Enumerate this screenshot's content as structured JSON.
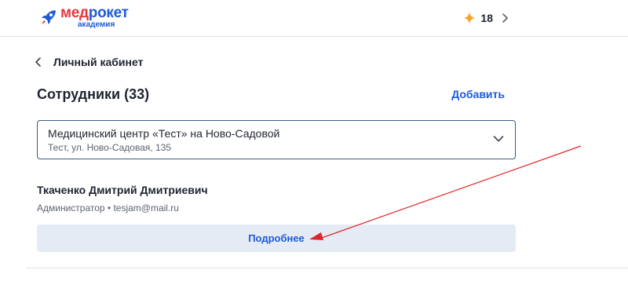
{
  "header": {
    "logo": {
      "brand_part1": "мед",
      "brand_part2": "рокет",
      "sub": "академия"
    },
    "bonus": {
      "count": "18",
      "icon": "star-icon"
    },
    "colors": {
      "brand_blue": "#1e5bd8",
      "brand_red": "#e8353b",
      "bonus_orange": "#f4a32a"
    }
  },
  "nav": {
    "back_label": "Личный кабинет",
    "back_icon": "chevron-left-icon"
  },
  "section": {
    "title": "Сотрудники (33)",
    "add_label": "Добавить"
  },
  "clinic_select": {
    "selected_main": "Медицинский центр «Тест» на Ново-Садовой",
    "selected_sub": "Тест, ул. Ново-Садовая, 135",
    "icon": "chevron-down-icon"
  },
  "employee": {
    "name": "Ткаченко Дмитрий Дмитриевич",
    "meta": "Администратор • tesjam@mail.ru",
    "details_label": "Подробнее"
  },
  "annotation": {
    "type": "red-arrow",
    "color": "#e0242b"
  }
}
